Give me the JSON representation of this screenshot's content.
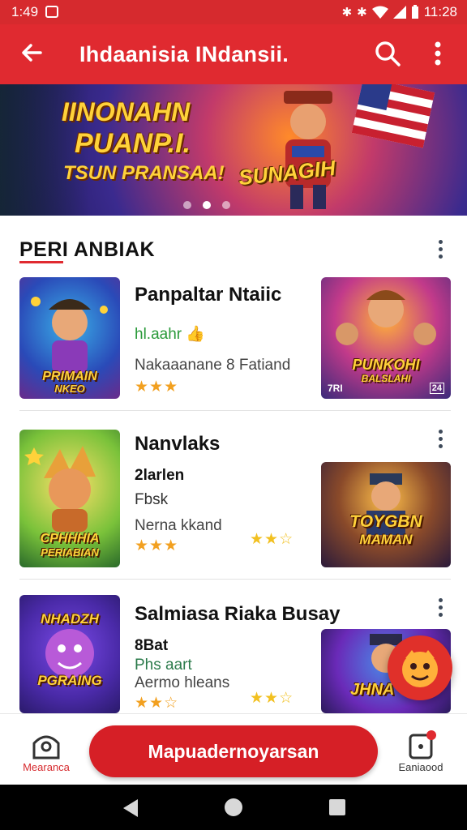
{
  "status_bar": {
    "time": "1:49",
    "right_time": "11:28"
  },
  "app_bar": {
    "title": "Ihdaanisia INdansii."
  },
  "banner": {
    "line1": "IINONAHN",
    "line2": "PUANP.I.",
    "line3": "TSUN PRANSAA!",
    "badge": "SUNAGIH",
    "slides": 3,
    "active_slide": 1
  },
  "section": {
    "title": "PERI ANBIAK"
  },
  "rows": [
    {
      "name": "Panpaltar Ntaiic",
      "sub": "hl.aahr 👍",
      "desc": "Nakaaanane 8 Fatiand",
      "stars": "★★★",
      "thumb_label_1": "PRIMAIN",
      "thumb_label_2": "NKEO",
      "side_label_1": "PUNKOHI",
      "side_label_2": "BALSLAHI",
      "side_corner_left": "7RI",
      "side_corner_right": "24"
    },
    {
      "name": "Nanvlaks",
      "sub": "2larlen",
      "sub2": "Fbsk",
      "desc": "Nerna kkand",
      "stars": "★★★",
      "extra_stars": "★★☆",
      "thumb_label_1": "CPHHHIA",
      "thumb_label_2": "PERIABIAN",
      "side_label_1": "TOYGBN",
      "side_label_2": "MAMAN"
    },
    {
      "name": "Salmiasa Riaka Busay",
      "sub": "8Bat",
      "sub2": "Phs aart",
      "desc": "Aermo hleans",
      "stars": "★★☆",
      "extra_stars": "★★☆",
      "thumb_label_1": "NHADZH",
      "thumb_label_2": "PGRAING",
      "side_label_1": "JHNA"
    }
  ],
  "bottom_bar": {
    "left_label": "Mearanca",
    "cta_label": "Mapuadernoyarsan",
    "right_label": "Eaniaood",
    "right_badge": "0"
  },
  "colors": {
    "primary": "#e02a30",
    "star": "#f2a020"
  }
}
